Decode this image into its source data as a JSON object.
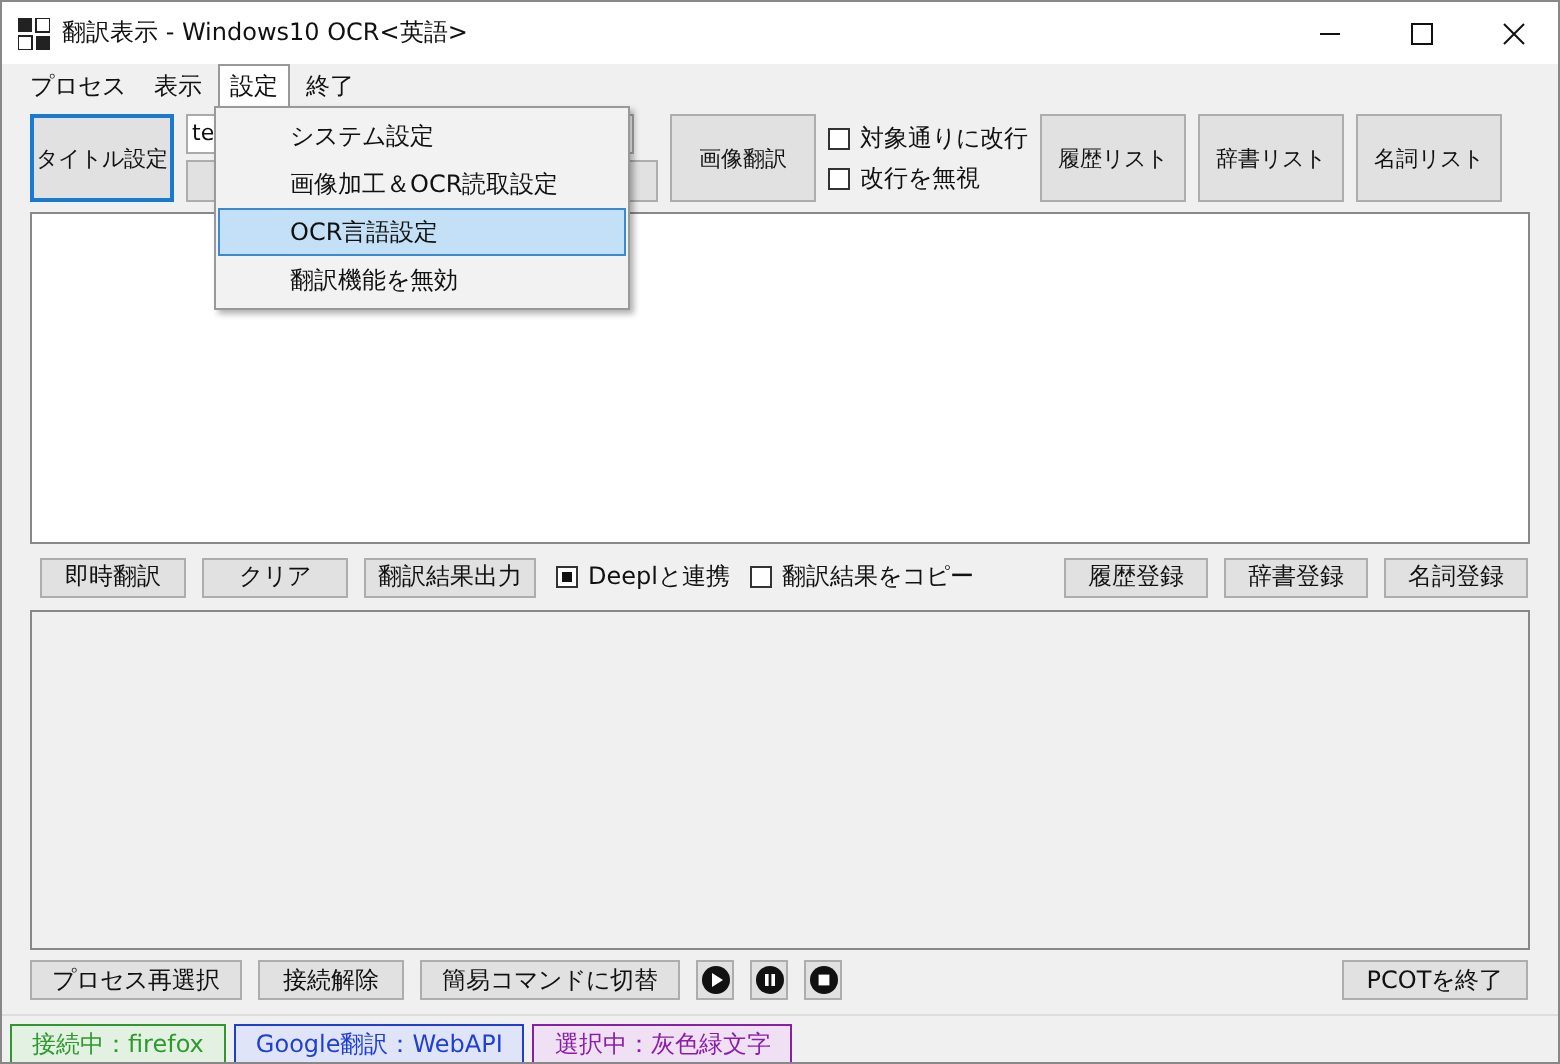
{
  "window": {
    "title": "翻訳表示 - Windows10 OCR<英語>"
  },
  "menu": [
    {
      "label": "プロセス",
      "selected": false
    },
    {
      "label": "表示",
      "selected": false
    },
    {
      "label": "設定",
      "selected": true
    },
    {
      "label": "終了",
      "selected": false
    }
  ],
  "dropdown": [
    {
      "label": "システム設定",
      "selected": false
    },
    {
      "label": "画像加工＆OCR読取設定",
      "selected": false
    },
    {
      "label": "OCR言語設定",
      "selected": true
    },
    {
      "label": "翻訳機能を無効",
      "selected": false
    }
  ],
  "toolbar": {
    "title_button": "タイトル設定",
    "combo_value": "te",
    "image_button": "画像翻訳",
    "checks": [
      {
        "label": "対象通りに改行",
        "checked": false
      },
      {
        "label": "改行を無視",
        "checked": false
      }
    ],
    "list_buttons": [
      "履歴リスト",
      "辞書リスト",
      "名詞リスト"
    ]
  },
  "actions": {
    "buttons": [
      "即時翻訳",
      "クリア",
      "翻訳結果出力"
    ],
    "checks": [
      {
        "label": "Deeplと連携",
        "checked": true
      },
      {
        "label": "翻訳結果をコピー",
        "checked": false
      }
    ],
    "register_buttons": [
      "履歴登録",
      "辞書登録",
      "名詞登録"
    ]
  },
  "bottom": {
    "buttons": [
      "プロセス再選択",
      "接続解除",
      "簡易コマンドに切替"
    ],
    "media": [
      {
        "kind": "play"
      },
      {
        "kind": "pause"
      },
      {
        "kind": "stop"
      }
    ],
    "exit_button": "PCOTを終了"
  },
  "status_bar": [
    {
      "text": "接続中：firefox",
      "color": "#2e9a2e"
    },
    {
      "text": "Google翻訳：WebAPI",
      "color": "#1f3fd0"
    },
    {
      "text": "選択中：灰色緑文字",
      "color": "#8a1ea8"
    }
  ]
}
